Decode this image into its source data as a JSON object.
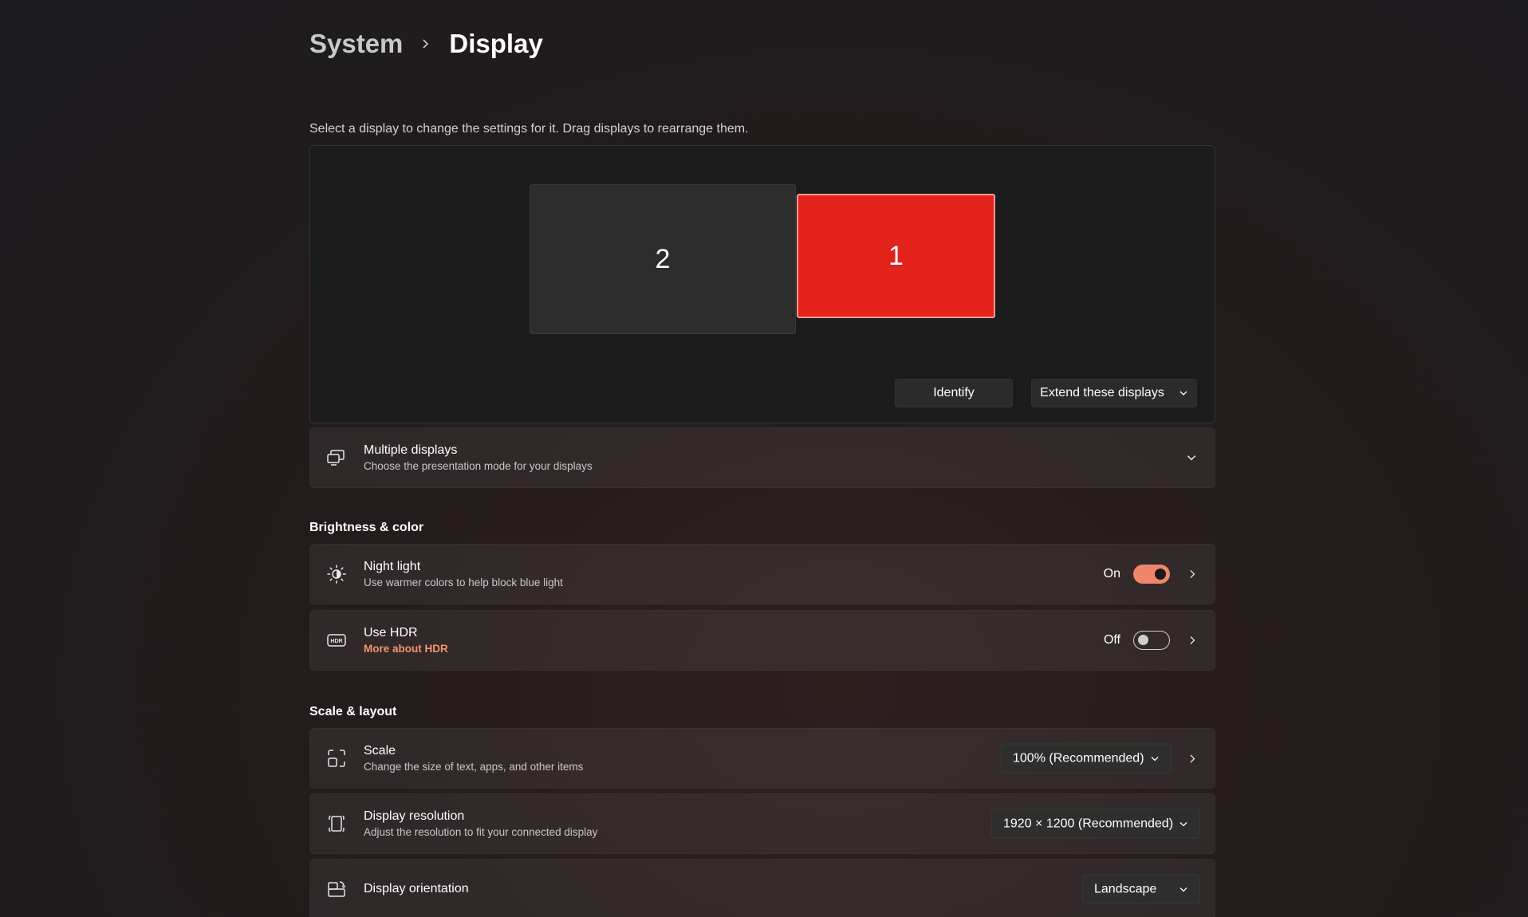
{
  "breadcrumb": {
    "parent": "System",
    "current": "Display"
  },
  "hint": "Select a display to change the settings for it. Drag displays to rearrange them.",
  "arrangement": {
    "monitors": [
      {
        "label": "2"
      },
      {
        "label": "1"
      }
    ],
    "identify_label": "Identify",
    "mode_label": "Extend these displays"
  },
  "multiple_displays": {
    "title": "Multiple displays",
    "subtitle": "Choose the presentation mode for your displays"
  },
  "sections": {
    "brightness": "Brightness & color",
    "scale_layout": "Scale & layout"
  },
  "night_light": {
    "title": "Night light",
    "subtitle": "Use warmer colors to help block blue light",
    "state_label": "On"
  },
  "hdr": {
    "title": "Use HDR",
    "link": "More about HDR",
    "state_label": "Off"
  },
  "scale": {
    "title": "Scale",
    "subtitle": "Change the size of text, apps, and other items",
    "value": "100% (Recommended)"
  },
  "resolution": {
    "title": "Display resolution",
    "subtitle": "Adjust the resolution to fit your connected display",
    "value": "1920 × 1200 (Recommended)"
  },
  "orientation": {
    "title": "Display orientation",
    "value": "Landscape"
  },
  "colors": {
    "accent": "#f0856b",
    "selected_monitor": "#e3231b",
    "link": "#f0956f"
  }
}
